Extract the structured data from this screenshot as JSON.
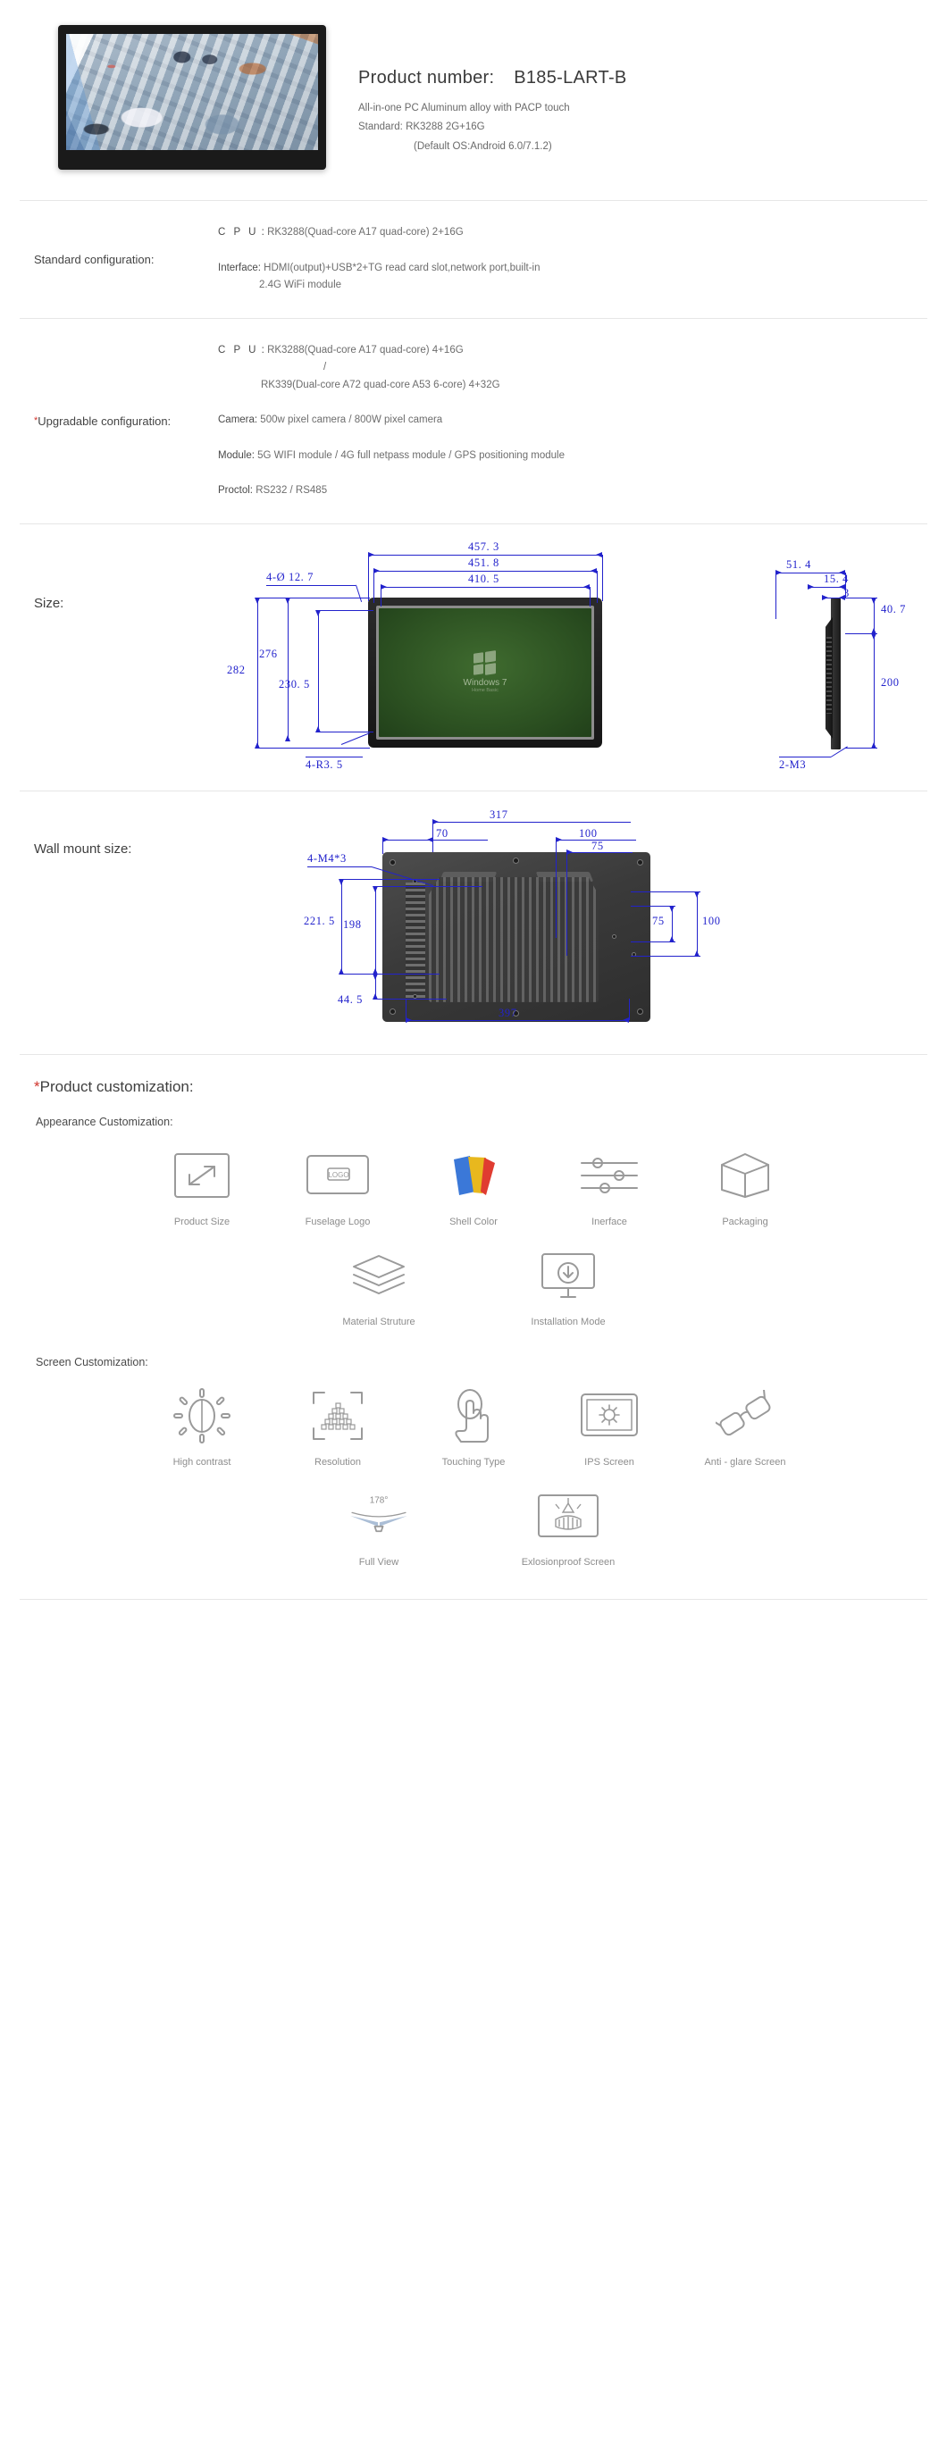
{
  "hero": {
    "product_number_label": "Product number:",
    "product_number_value": "B185-LART-B",
    "line1": "All-in-one PC Aluminum alloy with PACP touch",
    "line2": "Standard:  RK3288 2G+16G",
    "line3": "(Default OS:Android 6.0/7.1.2)"
  },
  "standard_config": {
    "label": "Standard configuration:",
    "cpu_key": "C P U",
    "cpu_sep": " : ",
    "cpu_value": "RK3288(Quad-core A17 quad-core) 2+16G",
    "interface_key": "Interface: ",
    "interface_value": "HDMI(output)+USB*2+TG read card slot,network port,built-in",
    "interface_value2": "2.4G WiFi module"
  },
  "upgradable_config": {
    "star": "*",
    "label": "Upgradable configuration:",
    "cpu_key": "C P U",
    "cpu_sep": " : ",
    "cpu_value": "RK3288(Quad-core A17 quad-core) 4+16G",
    "cpu_slash": "/",
    "cpu_value2": "RK339(Dual-core A72 quad-core A53 6-core) 4+32G",
    "camera_key": "Camera: ",
    "camera_value": "500w pixel camera / 800W pixel camera",
    "module_key": "Module: ",
    "module_value": "5G WIFI module / 4G full netpass module / GPS positioning module",
    "protocol_key": "Proctol: ",
    "protocol_value": "RS232 / RS485"
  },
  "size": {
    "label": "Size:",
    "dims": {
      "w_outer": "457. 3",
      "w_mid": "451. 8",
      "w_screen": "410. 5",
      "holes": "4-Ø 12. 7",
      "h_mid": "276",
      "h_outer": "282",
      "h_screen": "230. 5",
      "radius": "4-R3. 5",
      "side_total": "51. 4",
      "side_b": "15. 4",
      "side_c": "3",
      "side_top": "40. 7",
      "side_h": "200",
      "side_screw": "2-M3"
    },
    "screen_os": "Windows 7",
    "screen_os_sub": "Home Basic"
  },
  "wall_mount": {
    "label": "Wall mount size:",
    "dims": {
      "w_317": "317",
      "w_70": "70",
      "w_100": "100",
      "w_75": "75",
      "screws": "4-M4*3",
      "h_198": "198",
      "h_221": "221. 5",
      "h_44": "44. 5",
      "w_397": "397",
      "r_75": "75",
      "r_100": "100"
    }
  },
  "customization": {
    "star": "*",
    "title": "Product customization:",
    "appearance_title": "Appearance Customization:",
    "screen_title": "Screen Customization:",
    "appearance_row1": [
      {
        "icon": "resize-arrow-icon",
        "label": "Product Size"
      },
      {
        "icon": "logo-screen-icon",
        "label": "Fuselage Logo"
      },
      {
        "icon": "color-swatch-icon",
        "label": "Shell Color"
      },
      {
        "icon": "sliders-icon",
        "label": "Inerface"
      },
      {
        "icon": "box-icon",
        "label": "Packaging"
      }
    ],
    "appearance_row2": [
      {
        "icon": "layers-icon",
        "label": "Material Struture"
      },
      {
        "icon": "monitor-download-icon",
        "label": "Installation Mode"
      }
    ],
    "screen_row1": [
      {
        "icon": "brightness-icon",
        "label": "High contrast"
      },
      {
        "icon": "pixels-frame-icon",
        "label": "Resolution"
      },
      {
        "icon": "touch-hand-icon",
        "label": "Touching Type"
      },
      {
        "icon": "gear-screen-icon",
        "label": "IPS Screen"
      },
      {
        "icon": "glasses-icon",
        "label": "Anti - glare Screen"
      }
    ],
    "screen_row2": [
      {
        "icon": "viewing-angle-icon",
        "label": "Full View",
        "badge": "178°"
      },
      {
        "icon": "shield-screen-icon",
        "label": "Exlosionproof Screen"
      }
    ]
  },
  "colors": {
    "blueprint": "#2222cc",
    "accent_red": "#d0342c",
    "body_text": "#6d6d6d",
    "icon_stroke": "#9a9a9a"
  }
}
